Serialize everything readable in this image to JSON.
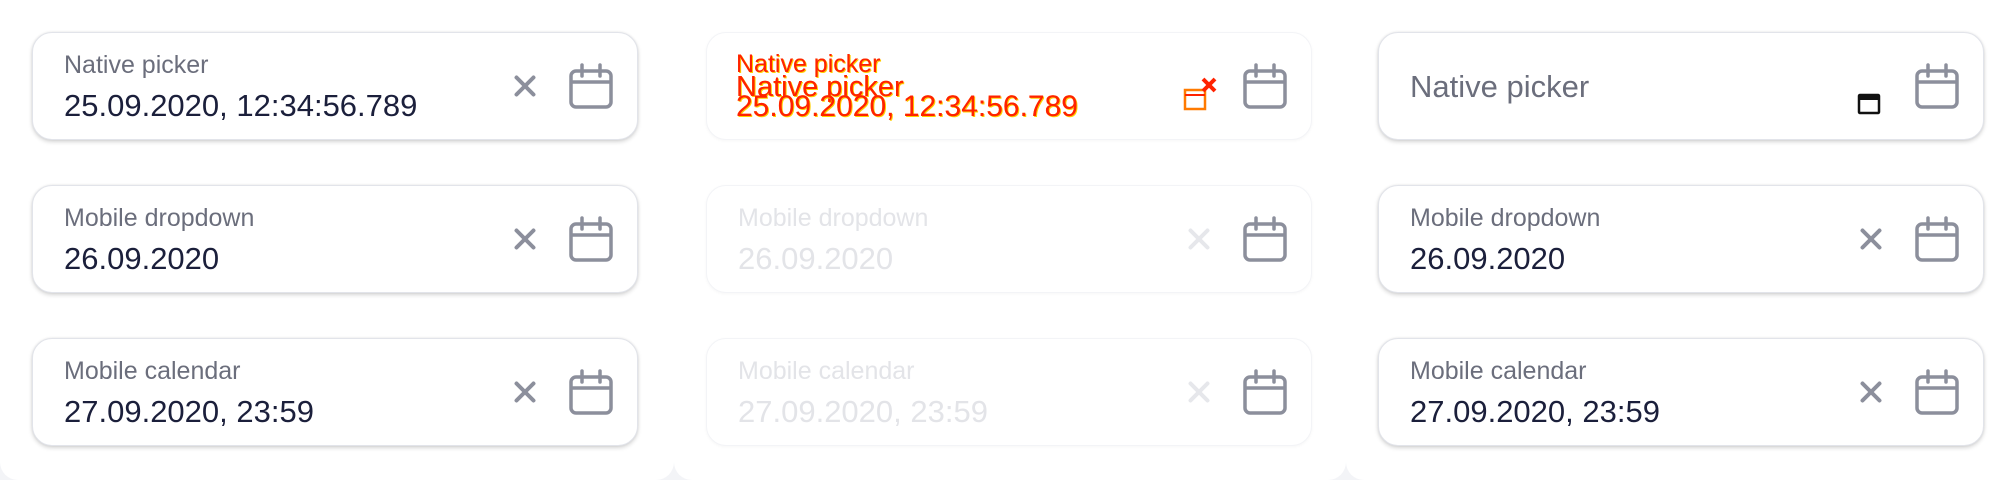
{
  "panels": {
    "left": {
      "fields": [
        {
          "label": "Native picker",
          "value": "25.09.2020, 12:34:56.789"
        },
        {
          "label": "Mobile dropdown",
          "value": "26.09.2020"
        },
        {
          "label": "Mobile calendar",
          "value": "27.09.2020, 23:59"
        }
      ]
    },
    "middle": {
      "native_overlay": {
        "label": "Native picker",
        "overlay_label": "Native picker",
        "value": "25.09.2020, 12:34:56.789"
      },
      "fields": [
        {
          "label": "Mobile dropdown",
          "value": "26.09.2020"
        },
        {
          "label": "Mobile calendar",
          "value": "27.09.2020, 23:59"
        }
      ]
    },
    "right": {
      "native_placeholder": "Native picker",
      "fields": [
        {
          "label": "Mobile dropdown",
          "value": "26.09.2020"
        },
        {
          "label": "Mobile calendar",
          "value": "27.09.2020, 23:59"
        }
      ]
    }
  },
  "icons": {
    "clear": "close-icon",
    "calendar": "calendar-icon"
  },
  "colors": {
    "text": "#1b1f3b",
    "label": "#6b6e7c",
    "glitch": "#ff2200"
  }
}
